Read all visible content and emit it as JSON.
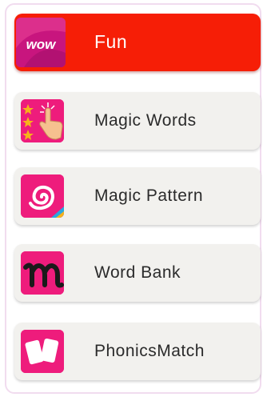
{
  "menu": {
    "items": [
      {
        "label": "Fun",
        "icon": "wow-icon",
        "icon_text": "wow",
        "active": true
      },
      {
        "label": "Magic Words",
        "icon": "magic-tap-icon",
        "active": false
      },
      {
        "label": "Magic Pattern",
        "icon": "spiral-icon",
        "active": false
      },
      {
        "label": "Word Bank",
        "icon": "letter-m-icon",
        "active": false
      },
      {
        "label": "PhonicsMatch",
        "icon": "cards-icon",
        "active": false
      }
    ]
  },
  "colors": {
    "active_bg": "#f61e06",
    "item_bg": "#f2f1ee",
    "icon_pink": "#ee1c7c",
    "panel_border": "#f1dcef"
  }
}
